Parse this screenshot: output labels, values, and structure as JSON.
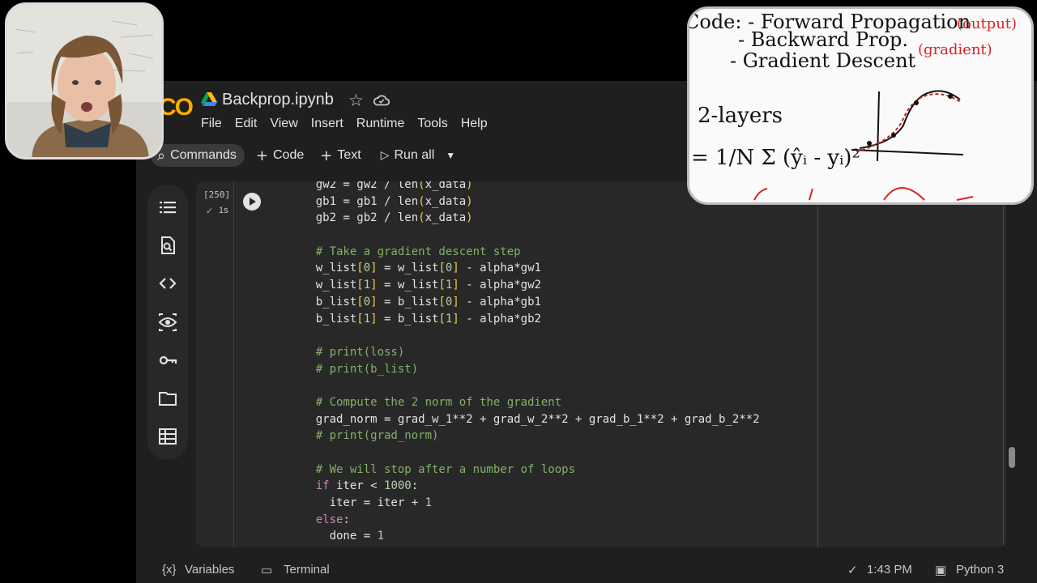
{
  "window": {
    "logo_text": "CO",
    "notebook_title": "Backprop.ipynb",
    "menu": [
      "File",
      "Edit",
      "View",
      "Insert",
      "Runtime",
      "Tools",
      "Help"
    ]
  },
  "toolbar": {
    "commands_label": "Commands",
    "code_label": "Code",
    "text_label": "Text",
    "run_all_label": "Run all"
  },
  "cell": {
    "execution_count": "[250]",
    "exec_time": "1s",
    "code_lines": [
      [
        [
          "op",
          "    gw2 = gw2 / len"
        ],
        [
          "br",
          "("
        ],
        [
          "op",
          "x_data"
        ],
        [
          "br",
          ")"
        ]
      ],
      [
        [
          "op",
          "    gb1 = gb1 / len"
        ],
        [
          "br",
          "("
        ],
        [
          "op",
          "x_data"
        ],
        [
          "br",
          ")"
        ]
      ],
      [
        [
          "op",
          "    gb2 = gb2 / len"
        ],
        [
          "br",
          "("
        ],
        [
          "op",
          "x_data"
        ],
        [
          "br",
          ")"
        ]
      ],
      [
        [
          "op",
          ""
        ]
      ],
      [
        [
          "cm",
          "    # Take a gradient descent step"
        ]
      ],
      [
        [
          "op",
          "    w_list"
        ],
        [
          "br",
          "["
        ],
        [
          "num",
          "0"
        ],
        [
          "br",
          "]"
        ],
        [
          "op",
          " = w_list"
        ],
        [
          "br",
          "["
        ],
        [
          "num",
          "0"
        ],
        [
          "br",
          "]"
        ],
        [
          "op",
          " - alpha*gw1"
        ]
      ],
      [
        [
          "op",
          "    w_list"
        ],
        [
          "br",
          "["
        ],
        [
          "num",
          "1"
        ],
        [
          "br",
          "]"
        ],
        [
          "op",
          " = w_list"
        ],
        [
          "br",
          "["
        ],
        [
          "num",
          "1"
        ],
        [
          "br",
          "]"
        ],
        [
          "op",
          " - alpha*gw2"
        ]
      ],
      [
        [
          "op",
          "    b_list"
        ],
        [
          "br",
          "["
        ],
        [
          "num",
          "0"
        ],
        [
          "br",
          "]"
        ],
        [
          "op",
          " = b_list"
        ],
        [
          "br",
          "["
        ],
        [
          "num",
          "0"
        ],
        [
          "br",
          "]"
        ],
        [
          "op",
          " - alpha*gb1"
        ]
      ],
      [
        [
          "op",
          "    b_list"
        ],
        [
          "br",
          "["
        ],
        [
          "num",
          "1"
        ],
        [
          "br",
          "]"
        ],
        [
          "op",
          " = b_list"
        ],
        [
          "br",
          "["
        ],
        [
          "num",
          "1"
        ],
        [
          "br",
          "]"
        ],
        [
          "op",
          " - alpha*gb2"
        ]
      ],
      [
        [
          "op",
          ""
        ]
      ],
      [
        [
          "cm",
          "    # print(loss)"
        ]
      ],
      [
        [
          "cm",
          "    # print(b_list)"
        ]
      ],
      [
        [
          "op",
          ""
        ]
      ],
      [
        [
          "cm",
          "    # Compute the 2 norm of the gradient"
        ]
      ],
      [
        [
          "op",
          "    grad_norm = grad_w_1**2 + grad_w_2**2 + grad_b_1**2 + grad_b_2**2"
        ]
      ],
      [
        [
          "cm",
          "    # print(grad_norm)"
        ]
      ],
      [
        [
          "op",
          ""
        ]
      ],
      [
        [
          "cm",
          "    # We will stop after a number of loops"
        ]
      ],
      [
        [
          "kw",
          "    if"
        ],
        [
          "op",
          " iter < "
        ],
        [
          "num",
          "1000"
        ],
        [
          "op",
          ":"
        ]
      ],
      [
        [
          "op",
          "      iter = iter + "
        ],
        [
          "num",
          "1"
        ]
      ],
      [
        [
          "kw",
          "    else"
        ],
        [
          "op",
          ":"
        ]
      ],
      [
        [
          "op",
          "      done = "
        ],
        [
          "num",
          "1"
        ]
      ]
    ]
  },
  "statusbar": {
    "variables_label": "Variables",
    "terminal_label": "Terminal",
    "time": "1:43 PM",
    "kernel": "Python 3"
  },
  "whiteboard": {
    "line1": "Code: - Forward Propagation",
    "line1_note": "(output)",
    "line2": "- Backward Prop.",
    "line2_note": "(gradient)",
    "line3": "- Gradient Descent",
    "line4": "2-layers",
    "formula": "= 1/N Σ (ŷᵢ - yᵢ)²"
  },
  "colors": {
    "background": "#1f1f1f",
    "cell": "#282828",
    "comment": "#84b06b",
    "bracket": "#f4d03f",
    "keyword": "#c586c0",
    "number": "#b5cea8"
  }
}
